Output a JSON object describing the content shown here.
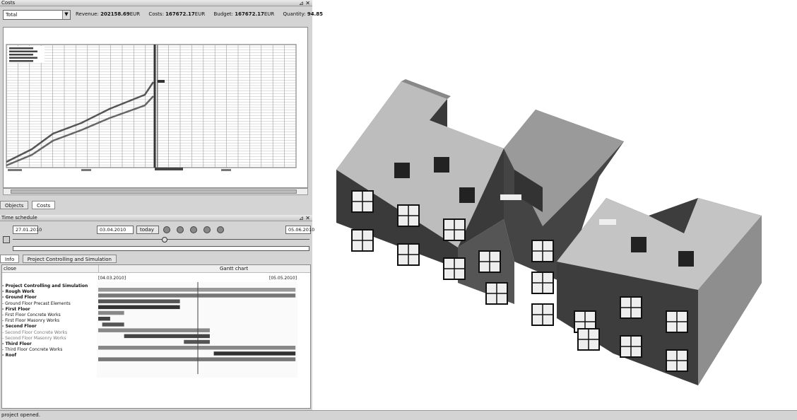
{
  "window": {
    "costs_title": "Costs",
    "time_title": "Time schedule",
    "status_text": "project opened."
  },
  "costs": {
    "selector_value": "Total",
    "revenue_label": "Revenue:",
    "revenue_value": "202158.69",
    "revenue_unit": "EUR",
    "costs_label": "Costs:",
    "costs_value": "167672.17",
    "costs_unit": "EUR",
    "budget_label": "Budget:",
    "budget_value": "167672.17",
    "budget_unit": "EUR",
    "quantity_label": "Quantity:",
    "quantity_value": "94.85"
  },
  "tabs_top": [
    "Objects",
    "Costs"
  ],
  "tabs_bottom": [
    "Info",
    "Project Controlling and Simulation"
  ],
  "schedule": {
    "start_date": "27.01.2010",
    "current_date": "03.04.2010",
    "today_label": "today",
    "end_date": "05.06.2010"
  },
  "gantt": {
    "col_name": "close",
    "col_chart": "Gantt chart",
    "date_left": "[04.03.2010]",
    "date_right": "[05.05.2010]",
    "rows": [
      {
        "label": "- Project Controlling and Simulation",
        "style": "bold"
      },
      {
        "label": "- Rough Work",
        "style": "bold"
      },
      {
        "label": "- Ground Floor",
        "style": "bold"
      },
      {
        "label": "- Ground Floor Precast Elements",
        "style": "normal"
      },
      {
        "label": "- First Floor",
        "style": "bold"
      },
      {
        "label": "- First Floor Concrete Works",
        "style": "normal"
      },
      {
        "label": "- First Floor Masonry Works",
        "style": "normal"
      },
      {
        "label": "- Second Floor",
        "style": "bold"
      },
      {
        "label": "- Second Floor Concrete Works",
        "style": "muted"
      },
      {
        "label": "- Second Floor Masonry Works",
        "style": "muted"
      },
      {
        "label": "- Third Floor",
        "style": "bold"
      },
      {
        "label": "- Third Floor Concrete Works",
        "style": "normal"
      },
      {
        "label": "- Roof",
        "style": "bold"
      }
    ],
    "bars": [
      {
        "start": 0.0,
        "end": 0.99,
        "shade": "#999999"
      },
      {
        "start": 0.0,
        "end": 0.99,
        "shade": "#777777"
      },
      {
        "start": 0.0,
        "end": 0.41,
        "shade": "#555555"
      },
      {
        "start": 0.0,
        "end": 0.41,
        "shade": "#333333"
      },
      {
        "start": 0.0,
        "end": 0.13,
        "shade": "#888888"
      },
      {
        "start": 0.0,
        "end": 0.06,
        "shade": "#444444"
      },
      {
        "start": 0.02,
        "end": 0.13,
        "shade": "#555555"
      },
      {
        "start": 0.0,
        "end": 0.56,
        "shade": "#888888"
      },
      {
        "start": 0.13,
        "end": 0.56,
        "shade": "#444444"
      },
      {
        "start": 0.43,
        "end": 0.56,
        "shade": "#555555"
      },
      {
        "start": 0.0,
        "end": 0.99,
        "shade": "#888888"
      },
      {
        "start": 0.58,
        "end": 0.99,
        "shade": "#333333"
      },
      {
        "start": 0.0,
        "end": 0.99,
        "shade": "#777777"
      }
    ],
    "today_marker": 0.5
  }
}
